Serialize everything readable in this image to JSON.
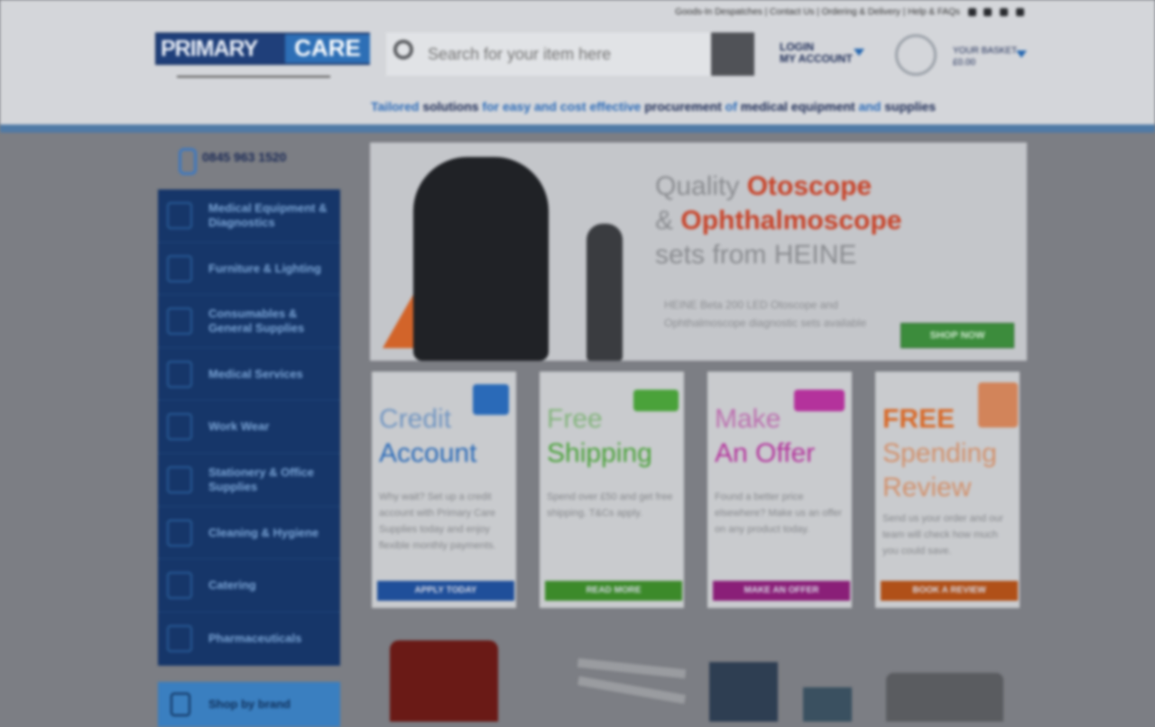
{
  "header": {
    "top_links": "Goods-In Despatches | Contact Us | Ordering & Delivery | Help & FAQs",
    "logo_primary": "PRIMARY",
    "logo_care": "CARE",
    "search_placeholder": "Search for your item here",
    "account": {
      "line1": "LOGIN",
      "line2": "MY ACCOUNT"
    },
    "basket": {
      "line1": "YOUR BASKET",
      "line2": "£0.00"
    },
    "tagline": {
      "part1": "Tailored ",
      "part2": "solutions",
      "part3": " for easy and cost effective ",
      "part4": "procurement",
      "part5": " of ",
      "part6": "medical equipment",
      "part7": " and ",
      "part8": "supplies"
    }
  },
  "phone": "0845 963 1520",
  "sidebar": {
    "items": [
      {
        "label": "Medical Equipment & Diagnostics",
        "icon": "stethoscope-icon"
      },
      {
        "label": "Furniture & Lighting",
        "icon": "lamp-icon"
      },
      {
        "label": "Consumables & General Supplies",
        "icon": "box-icon"
      },
      {
        "label": "Medical Services",
        "icon": "wrench-icon"
      },
      {
        "label": "Work Wear",
        "icon": "tshirt-icon"
      },
      {
        "label": "Stationery & Office Supplies",
        "icon": "pen-icon"
      },
      {
        "label": "Cleaning & Hygiene",
        "icon": "spray-icon"
      },
      {
        "label": "Catering",
        "icon": "cup-icon"
      },
      {
        "label": "Pharmaceuticals",
        "icon": "pill-icon"
      }
    ],
    "shop_by_brand": "Shop by brand"
  },
  "hero": {
    "title_line1_a": "Quality ",
    "title_line1_b": "Otoscope",
    "title_line2_a": "& ",
    "title_line2_b": "Ophthalmoscope",
    "title_line3": "sets from HEINE",
    "sub_line1": "HEINE Beta 200 LED Otoscope and",
    "sub_line2": "Ophthalmoscope diagnostic sets available",
    "button": "SHOP NOW"
  },
  "promos": [
    {
      "line1": "Credit",
      "line2": "Account",
      "text": "Why wait? Set up a credit account with Primary Care Supplies today and enjoy flexible monthly payments.",
      "button": "APPLY TODAY",
      "color": "#2a6ab8",
      "btn_color": "#1f4f9a"
    },
    {
      "line1": "Free",
      "line2": "Shipping",
      "text": "Spend over £50 and get free shipping. T&Cs apply.",
      "button": "READ MORE",
      "color": "#4aa23a",
      "btn_color": "#3c8a2a"
    },
    {
      "line1": "Make",
      "line2": "An Offer",
      "text": "Found a better price elsewhere? Make us an offer on any product today.",
      "button": "MAKE AN OFFER",
      "color": "#b4329c",
      "btn_color": "#8a1f78"
    },
    {
      "line1": "FREE",
      "line2": "Spending",
      "line3": "Review",
      "text": "Send us your order and our team will check how much you could save.",
      "button": "BOOK A REVIEW",
      "color": "#d86a2a",
      "btn_color": "#b05018"
    }
  ]
}
